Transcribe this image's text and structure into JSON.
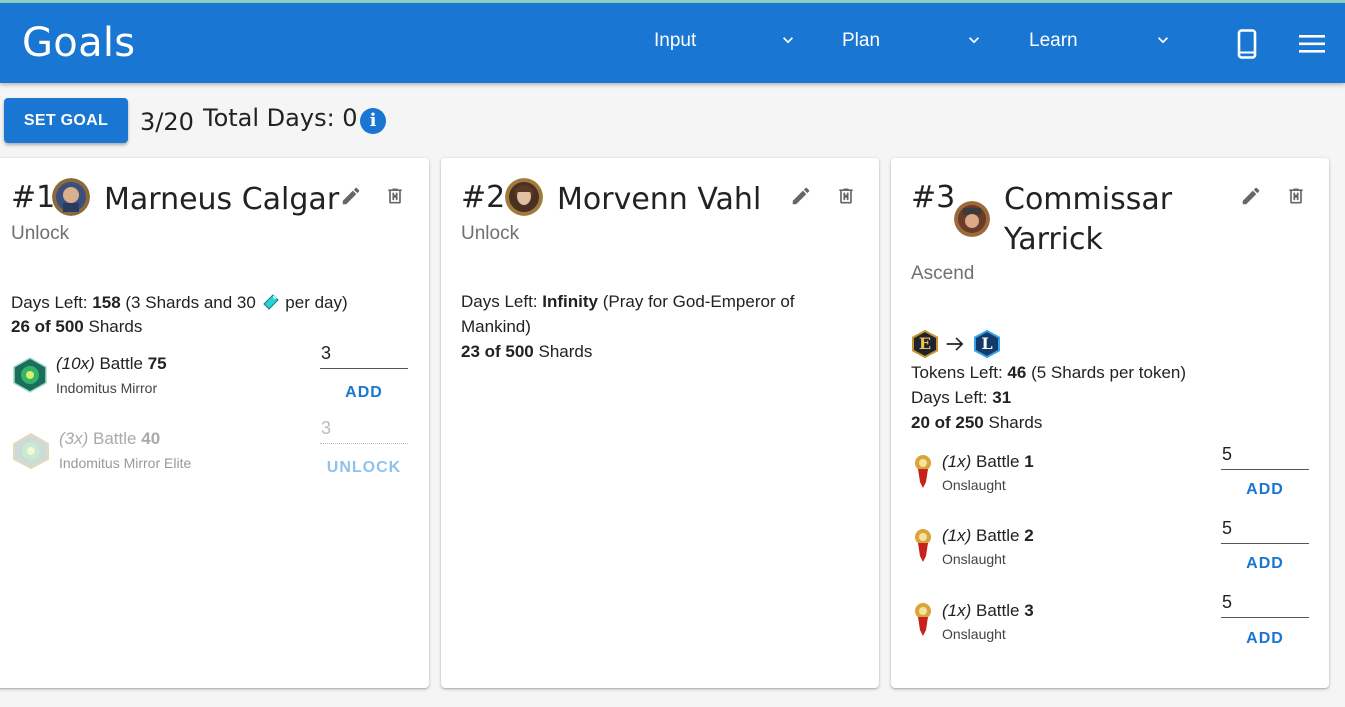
{
  "appbar": {
    "title": "Goals",
    "nav": [
      {
        "label": "Input"
      },
      {
        "label": "Plan"
      },
      {
        "label": "Learn"
      }
    ]
  },
  "toolbar": {
    "set_goal_label": "SET GOAL",
    "goal_count": "3/20",
    "total_days": "Total Days: 0",
    "info_glyph": "i"
  },
  "goals": [
    {
      "number": "#1",
      "name": "Marneus Calgar",
      "type": "Unlock",
      "days_left_label": "Days Left:",
      "days_left": "158",
      "rate_text": "(3 Shards and 30",
      "rate_suffix": "per day)",
      "shards_progress": "26 of 500",
      "shards_label": "Shards",
      "battles": [
        {
          "count": "(10x)",
          "battle_label": "Battle",
          "battle_num": "75",
          "location": "Indomitus Mirror",
          "value": "3",
          "action": "ADD",
          "enabled": true
        },
        {
          "count": "(3x)",
          "battle_label": "Battle",
          "battle_num": "40",
          "location": "Indomitus Mirror Elite",
          "value": "3",
          "action": "UNLOCK",
          "enabled": false
        }
      ]
    },
    {
      "number": "#2",
      "name": "Morvenn Vahl",
      "type": "Unlock",
      "days_left_label": "Days Left:",
      "days_left": "Infinity",
      "note_line1": "(Pray for God-Emperor of",
      "note_line2": "Mankind)",
      "shards_progress": "23 of 500",
      "shards_label": "Shards"
    },
    {
      "number": "#3",
      "name_line1": "Commissar",
      "name_line2": "Yarrick",
      "type": "Ascend",
      "rank_from": "E",
      "rank_to": "L",
      "tokens_left_label": "Tokens Left:",
      "tokens_left": "46",
      "tokens_note": "(5 Shards per token)",
      "days_left_label": "Days Left:",
      "days_left": "31",
      "shards_progress": "20 of 250",
      "shards_label": "Shards",
      "battles": [
        {
          "count": "(1x)",
          "battle_label": "Battle",
          "battle_num": "1",
          "location": "Onslaught",
          "value": "5",
          "action": "ADD"
        },
        {
          "count": "(1x)",
          "battle_label": "Battle",
          "battle_num": "2",
          "location": "Onslaught",
          "value": "5",
          "action": "ADD"
        },
        {
          "count": "(1x)",
          "battle_label": "Battle",
          "battle_num": "3",
          "location": "Onslaught",
          "value": "5",
          "action": "ADD"
        }
      ]
    }
  ],
  "colors": {
    "primary": "#1976d2",
    "appbar_text": "#ffffff",
    "secondary_text": "#707070",
    "card_bg": "#ffffff",
    "page_bg": "#f5f5f5"
  },
  "icons": [
    "chevron-down-icon",
    "phone-icon",
    "menu-icon",
    "info-icon",
    "edit-icon",
    "delete-icon",
    "orb-icon",
    "campaign-icon",
    "onslaught-icon",
    "arrow-right-icon",
    "rank-e-icon",
    "rank-l-icon"
  ]
}
